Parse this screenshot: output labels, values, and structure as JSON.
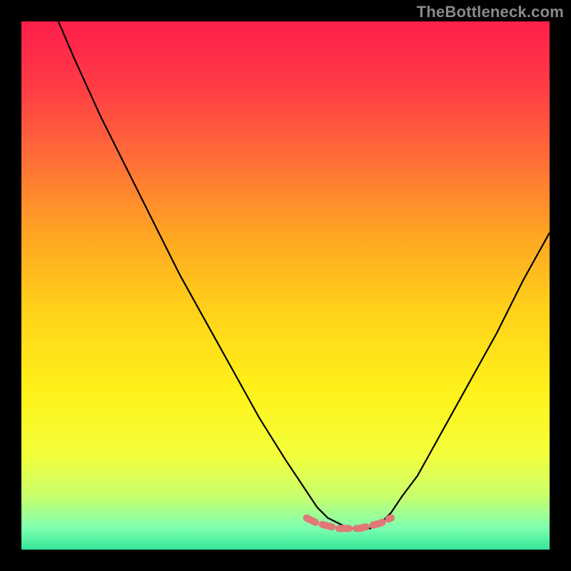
{
  "watermark": "TheBottleneck.com",
  "chart_data": {
    "type": "line",
    "title": "",
    "xlabel": "",
    "ylabel": "",
    "xlim": [
      0,
      100
    ],
    "ylim": [
      0,
      100
    ],
    "grid": false,
    "series": [
      {
        "name": "bottleneck-curve",
        "color": "#000000",
        "x": [
          7,
          10,
          15,
          20,
          25,
          30,
          35,
          40,
          45,
          50,
          52,
          54,
          56,
          58,
          60,
          62,
          64,
          66,
          68,
          70,
          72,
          75,
          80,
          85,
          90,
          95,
          100
        ],
        "values": [
          100,
          93,
          82,
          72,
          62,
          52,
          43,
          34,
          25,
          17,
          14,
          11,
          8,
          6,
          5,
          4,
          4,
          4,
          5,
          7,
          10,
          14,
          23,
          32,
          41,
          51,
          60
        ]
      },
      {
        "name": "flat-region-marker",
        "color": "#e07878",
        "x": [
          54,
          56,
          58,
          60,
          62,
          64,
          66,
          68,
          70
        ],
        "values": [
          6,
          5,
          4.5,
          4,
          4,
          4,
          4.5,
          5,
          6
        ]
      }
    ],
    "background_gradient": {
      "stops": [
        {
          "pos": 0.0,
          "color": "#ff1f4b"
        },
        {
          "pos": 0.12,
          "color": "#ff3b46"
        },
        {
          "pos": 0.25,
          "color": "#ff6a39"
        },
        {
          "pos": 0.4,
          "color": "#ffa423"
        },
        {
          "pos": 0.55,
          "color": "#ffd21a"
        },
        {
          "pos": 0.7,
          "color": "#fff21a"
        },
        {
          "pos": 0.82,
          "color": "#f3ff3a"
        },
        {
          "pos": 0.9,
          "color": "#c8ff6e"
        },
        {
          "pos": 0.96,
          "color": "#7dffb0"
        },
        {
          "pos": 1.0,
          "color": "#33e59a"
        }
      ]
    }
  }
}
